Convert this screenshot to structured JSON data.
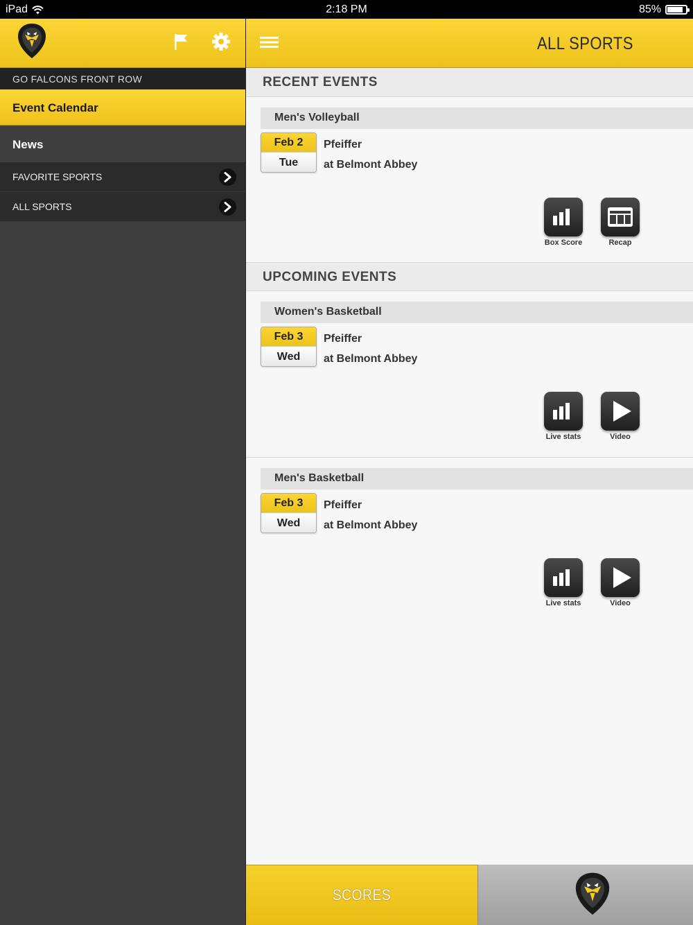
{
  "status_bar": {
    "device": "iPad",
    "time": "2:18 PM",
    "battery": "85%",
    "battery_level": 0.85
  },
  "sidebar": {
    "section_title": "GO FALCONS FRONT ROW",
    "active_item": "Event Calendar",
    "news_item": "News",
    "rows": [
      {
        "label": "FAVORITE SPORTS"
      },
      {
        "label": "ALL SPORTS"
      }
    ]
  },
  "header": {
    "title": "ALL SPORTS"
  },
  "recent": {
    "title": "RECENT EVENTS",
    "events": [
      {
        "sport": "Men's Volleyball",
        "date": "Feb 2",
        "day": "Tue",
        "opponent": "Pfeiffer",
        "location": "at Belmont Abbey",
        "actions": [
          {
            "label": "Box Score",
            "icon": "bar-chart-icon"
          },
          {
            "label": "Recap",
            "icon": "newspaper-icon"
          }
        ]
      }
    ]
  },
  "upcoming": {
    "title": "UPCOMING EVENTS",
    "events": [
      {
        "sport": "Women's Basketball",
        "date": "Feb 3",
        "day": "Wed",
        "opponent": "Pfeiffer",
        "location": "at Belmont Abbey",
        "actions": [
          {
            "label": "Live stats",
            "icon": "bar-chart-icon"
          },
          {
            "label": "Video",
            "icon": "play-icon"
          }
        ]
      },
      {
        "sport": "Men's Basketball",
        "date": "Feb 3",
        "day": "Wed",
        "opponent": "Pfeiffer",
        "location": "at Belmont Abbey",
        "actions": [
          {
            "label": "Live stats",
            "icon": "bar-chart-icon"
          },
          {
            "label": "Video",
            "icon": "play-icon"
          }
        ]
      }
    ]
  },
  "tabs": {
    "scores": "SCORES",
    "home_icon": "falcon-logo-icon"
  },
  "colors": {
    "accent": "#f5cc26",
    "sidebar": "#3f3f3f",
    "background": "#f7f7f7"
  }
}
